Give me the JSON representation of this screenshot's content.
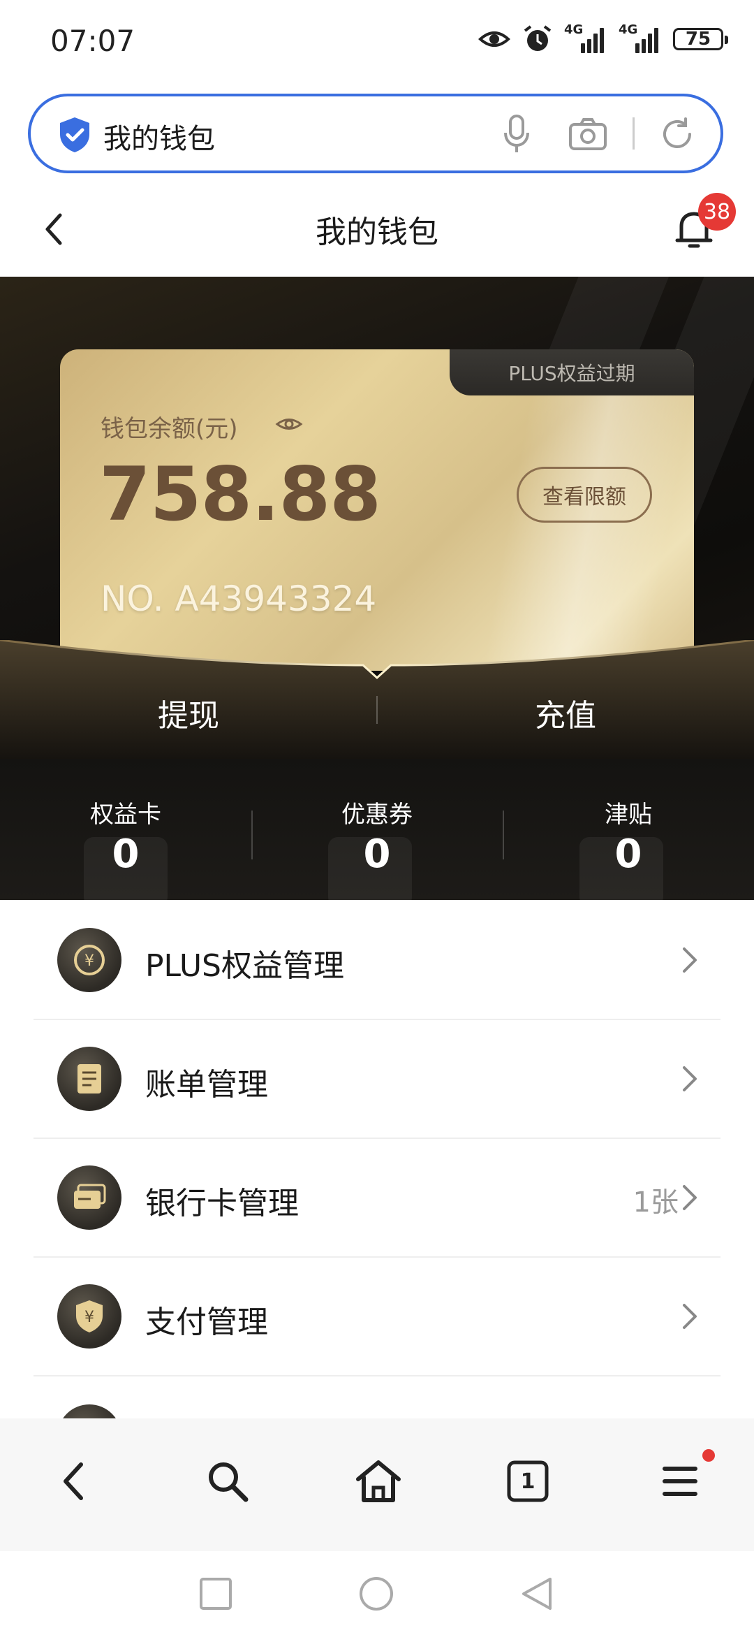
{
  "status_bar": {
    "time": "07:07",
    "network_1": "4G",
    "network_2": "4G",
    "battery": "75",
    "icons": [
      "eye-icon",
      "alarm-icon",
      "signal-icon",
      "signal-icon",
      "battery-icon"
    ]
  },
  "search": {
    "query": "我的钱包",
    "icons": [
      "shield-check-icon",
      "microphone-icon",
      "camera-icon",
      "refresh-icon"
    ]
  },
  "header": {
    "title": "我的钱包",
    "notification_count": "38"
  },
  "wallet": {
    "plus_status": "PLUS权益过期",
    "balance_label": "钱包余额(元)",
    "balance": "758.88",
    "limit_button": "查看限额",
    "card_number": "NO. A43943324",
    "actions": {
      "withdraw": "提现",
      "recharge": "充值"
    }
  },
  "stats": [
    {
      "label": "权益卡",
      "value": "0"
    },
    {
      "label": "优惠券",
      "value": "0"
    },
    {
      "label": "津贴",
      "value": "0"
    }
  ],
  "menu": [
    {
      "label": "PLUS权益管理",
      "extra": "",
      "icon": "coin-icon"
    },
    {
      "label": "账单管理",
      "extra": "",
      "icon": "bill-icon"
    },
    {
      "label": "银行卡管理",
      "extra": "1张",
      "icon": "bank-card-icon"
    },
    {
      "label": "支付管理",
      "extra": "",
      "icon": "payment-shield-icon"
    }
  ],
  "browser_bar": {
    "tab_count": "1",
    "icons": [
      "back-icon",
      "search-icon",
      "home-icon",
      "tabs-icon",
      "menu-icon"
    ]
  },
  "colors": {
    "accent_blue": "#3a6ee0",
    "badge_red": "#e53935",
    "gold": "#d9c28a",
    "balance_brown": "#6b5037"
  }
}
